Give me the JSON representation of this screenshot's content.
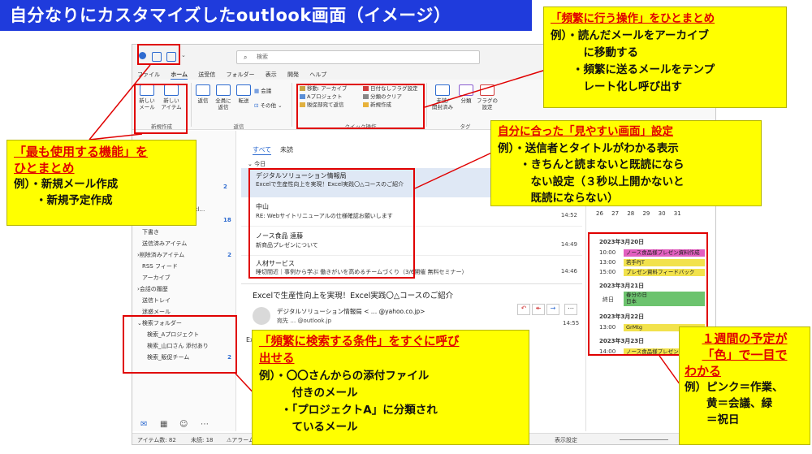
{
  "banner": {
    "title": "自分なりにカスタマイズしたoutlook画面（イメージ）"
  },
  "window": {
    "search_placeholder": "検索",
    "menu": [
      "ファイル",
      "ホーム",
      "送受信",
      "フォルダー",
      "表示",
      "開発",
      "ヘルプ"
    ],
    "ribbon": {
      "new_mail": "新しい\nメール",
      "new_item": "新しい\nアイテム",
      "group_new": "新規作成",
      "reply": "返信",
      "reply_all": "全員に\n返信",
      "forward": "転送",
      "meeting": "会議",
      "more": "その他",
      "group_respond": "返信",
      "quicksteps": [
        "移動: アーカイブ",
        "Aプロジェクト",
        "販促部宛て返信"
      ],
      "quicksteps2": [
        "日付なしフラグ設定",
        "分類のクリア",
        "新規作成"
      ],
      "group_quickstep": "クイック操作",
      "unread": "未読/\n開封済み",
      "categorize": "分類",
      "flag": "フラグの\n設定",
      "group_tags": "タグ"
    },
    "folders": {
      "account_badge": "2",
      "account_name": "@outl…",
      "account_count": "18",
      "items": [
        {
          "label": "下書き",
          "count": ""
        },
        {
          "label": "送信済みアイテム",
          "count": ""
        },
        {
          "label": "削除済みアイテム",
          "count": "2"
        },
        {
          "label": "RSS フィード",
          "count": ""
        },
        {
          "label": "アーカイブ",
          "count": ""
        },
        {
          "label": "会話の履歴",
          "count": ""
        },
        {
          "label": "送信トレイ",
          "count": ""
        },
        {
          "label": "迷惑メール",
          "count": ""
        },
        {
          "label": "検索フォルダー",
          "count": ""
        },
        {
          "label": "検索_Aプロジェクト",
          "count": ""
        },
        {
          "label": "検索_山口さん 添付あり",
          "count": ""
        },
        {
          "label": "検索_販促チーム",
          "count": "2"
        }
      ]
    },
    "mail_list": {
      "tab_all": "すべて",
      "tab_unread": "未読",
      "group_today": "今日",
      "messages": [
        {
          "sender": "デジタルソリューション情報局",
          "subject": "Excelで生産性向上を実現！Excel実践〇△コースのご紹介",
          "time": ""
        },
        {
          "sender": "中山",
          "subject": "RE: Webサイトリニューアルの仕様確認お願いします",
          "time": "14:52"
        },
        {
          "sender": "ノース食品 遠藤",
          "subject": "新商品プレゼンについて",
          "time": "14:49"
        },
        {
          "sender": "人材サービス",
          "subject": "睡切間近｜事例から学ぶ 働きがいを高めるチームづくり（3/6開催 無料セミナー）",
          "time": "14:46"
        }
      ]
    },
    "reading": {
      "subject": "Excelで生産性向上を実現！Excel実践〇△コースのご紹介",
      "from": "デジタルソリューション情報局 <",
      "from_domain": "@yahoo.co.jp>",
      "to_label": "宛先",
      "to_domain": "@outlook.jp",
      "time": "14:55",
      "body_start": "Ex"
    },
    "calendar": {
      "mini_days": [
        "26",
        "27",
        "28",
        "29",
        "30",
        "31"
      ],
      "days": [
        {
          "date": "2023年3月20日",
          "events": [
            {
              "time": "10:00",
              "title": "ノース食品様プレゼン資料作成",
              "color": "#e25fc0"
            },
            {
              "time": "13:00",
              "title": "若手PJT",
              "color": "#f2e24c"
            },
            {
              "time": "15:00",
              "title": "プレゼン資料フィードバック",
              "color": "#f2e24c"
            }
          ]
        },
        {
          "date": "2023年3月21日",
          "events": [
            {
              "time": "終日",
              "title": "春分の日\n日本",
              "color": "#6cc36e"
            }
          ]
        },
        {
          "date": "2023年3月22日",
          "events": [
            {
              "time": "13:00",
              "title": "GrMtg",
              "color": "#f2e24c"
            }
          ]
        },
        {
          "date": "2023年3月23日",
          "events": [
            {
              "time": "14:00",
              "title": "ノース食品様プレゼン",
              "color": "#f2e24c"
            }
          ]
        }
      ]
    },
    "status": {
      "items": "アイテム数: 82",
      "unread": "未読: 18",
      "alarm": "アラーム: 1",
      "view_settings": "表示設定"
    }
  },
  "callouts": {
    "quick_ops": {
      "title": "「頻繁に行う操作」をひとまとめ",
      "lines": [
        "例）・読んだメールをアーカイブ",
        "　　　に移動する",
        "　　・頻繁に送るメールをテンプ",
        "　　　レート化し呼び出す"
      ]
    },
    "view": {
      "title": "自分に合った「見やすい画面」設定",
      "lines": [
        "例）・送信者とタイトルがわかる表示",
        "　　・きちんと読まないと既読になら",
        "　　　ない設定（３秒以上開かないと",
        "　　　既読にならない）"
      ]
    },
    "most_used": {
      "title1": "「最も使用する機能」を",
      "title2": "ひとまとめ",
      "lines": [
        "例）・新規メール作成",
        "　　・新規予定作成"
      ]
    },
    "search": {
      "title1": "「頻繁に検索する条件」をすぐに呼び",
      "title2": "出せる",
      "lines": [
        "例）・〇〇さんからの添付ファイル",
        "　　　付きのメール",
        "　　・「プロジェクトA」に分類され",
        "　　　ているメール"
      ]
    },
    "week": {
      "title1": "１週間の予定が",
      "title2": "「色」で一目で",
      "title3": "わかる",
      "lines": [
        "例）ピンク＝作業、",
        "　　黄＝会議、緑",
        "　　＝祝日"
      ]
    }
  }
}
